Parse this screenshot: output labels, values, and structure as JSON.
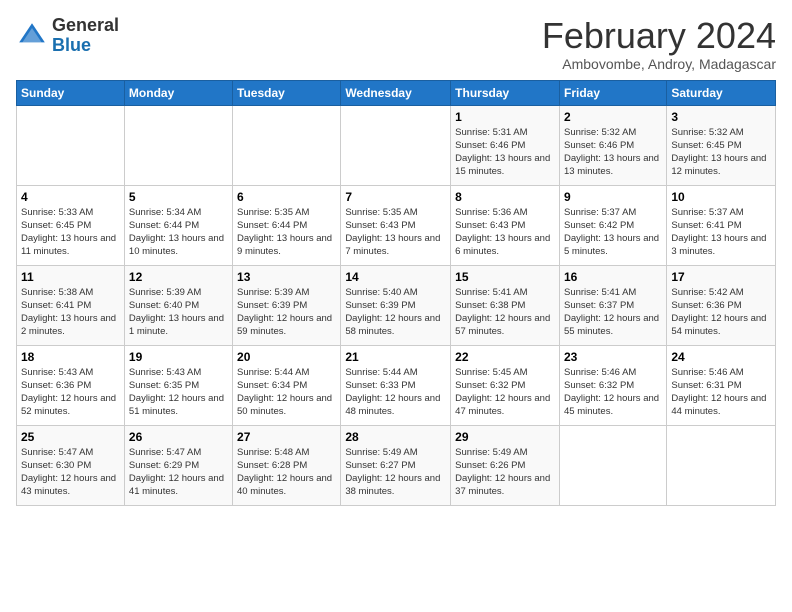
{
  "header": {
    "logo_general": "General",
    "logo_blue": "Blue",
    "month_title": "February 2024",
    "location": "Ambovombe, Androy, Madagascar"
  },
  "weekdays": [
    "Sunday",
    "Monday",
    "Tuesday",
    "Wednesday",
    "Thursday",
    "Friday",
    "Saturday"
  ],
  "weeks": [
    [
      {
        "day": "",
        "info": ""
      },
      {
        "day": "",
        "info": ""
      },
      {
        "day": "",
        "info": ""
      },
      {
        "day": "",
        "info": ""
      },
      {
        "day": "1",
        "info": "Sunrise: 5:31 AM\nSunset: 6:46 PM\nDaylight: 13 hours and 15 minutes."
      },
      {
        "day": "2",
        "info": "Sunrise: 5:32 AM\nSunset: 6:46 PM\nDaylight: 13 hours and 13 minutes."
      },
      {
        "day": "3",
        "info": "Sunrise: 5:32 AM\nSunset: 6:45 PM\nDaylight: 13 hours and 12 minutes."
      }
    ],
    [
      {
        "day": "4",
        "info": "Sunrise: 5:33 AM\nSunset: 6:45 PM\nDaylight: 13 hours and 11 minutes."
      },
      {
        "day": "5",
        "info": "Sunrise: 5:34 AM\nSunset: 6:44 PM\nDaylight: 13 hours and 10 minutes."
      },
      {
        "day": "6",
        "info": "Sunrise: 5:35 AM\nSunset: 6:44 PM\nDaylight: 13 hours and 9 minutes."
      },
      {
        "day": "7",
        "info": "Sunrise: 5:35 AM\nSunset: 6:43 PM\nDaylight: 13 hours and 7 minutes."
      },
      {
        "day": "8",
        "info": "Sunrise: 5:36 AM\nSunset: 6:43 PM\nDaylight: 13 hours and 6 minutes."
      },
      {
        "day": "9",
        "info": "Sunrise: 5:37 AM\nSunset: 6:42 PM\nDaylight: 13 hours and 5 minutes."
      },
      {
        "day": "10",
        "info": "Sunrise: 5:37 AM\nSunset: 6:41 PM\nDaylight: 13 hours and 3 minutes."
      }
    ],
    [
      {
        "day": "11",
        "info": "Sunrise: 5:38 AM\nSunset: 6:41 PM\nDaylight: 13 hours and 2 minutes."
      },
      {
        "day": "12",
        "info": "Sunrise: 5:39 AM\nSunset: 6:40 PM\nDaylight: 13 hours and 1 minute."
      },
      {
        "day": "13",
        "info": "Sunrise: 5:39 AM\nSunset: 6:39 PM\nDaylight: 12 hours and 59 minutes."
      },
      {
        "day": "14",
        "info": "Sunrise: 5:40 AM\nSunset: 6:39 PM\nDaylight: 12 hours and 58 minutes."
      },
      {
        "day": "15",
        "info": "Sunrise: 5:41 AM\nSunset: 6:38 PM\nDaylight: 12 hours and 57 minutes."
      },
      {
        "day": "16",
        "info": "Sunrise: 5:41 AM\nSunset: 6:37 PM\nDaylight: 12 hours and 55 minutes."
      },
      {
        "day": "17",
        "info": "Sunrise: 5:42 AM\nSunset: 6:36 PM\nDaylight: 12 hours and 54 minutes."
      }
    ],
    [
      {
        "day": "18",
        "info": "Sunrise: 5:43 AM\nSunset: 6:36 PM\nDaylight: 12 hours and 52 minutes."
      },
      {
        "day": "19",
        "info": "Sunrise: 5:43 AM\nSunset: 6:35 PM\nDaylight: 12 hours and 51 minutes."
      },
      {
        "day": "20",
        "info": "Sunrise: 5:44 AM\nSunset: 6:34 PM\nDaylight: 12 hours and 50 minutes."
      },
      {
        "day": "21",
        "info": "Sunrise: 5:44 AM\nSunset: 6:33 PM\nDaylight: 12 hours and 48 minutes."
      },
      {
        "day": "22",
        "info": "Sunrise: 5:45 AM\nSunset: 6:32 PM\nDaylight: 12 hours and 47 minutes."
      },
      {
        "day": "23",
        "info": "Sunrise: 5:46 AM\nSunset: 6:32 PM\nDaylight: 12 hours and 45 minutes."
      },
      {
        "day": "24",
        "info": "Sunrise: 5:46 AM\nSunset: 6:31 PM\nDaylight: 12 hours and 44 minutes."
      }
    ],
    [
      {
        "day": "25",
        "info": "Sunrise: 5:47 AM\nSunset: 6:30 PM\nDaylight: 12 hours and 43 minutes."
      },
      {
        "day": "26",
        "info": "Sunrise: 5:47 AM\nSunset: 6:29 PM\nDaylight: 12 hours and 41 minutes."
      },
      {
        "day": "27",
        "info": "Sunrise: 5:48 AM\nSunset: 6:28 PM\nDaylight: 12 hours and 40 minutes."
      },
      {
        "day": "28",
        "info": "Sunrise: 5:49 AM\nSunset: 6:27 PM\nDaylight: 12 hours and 38 minutes."
      },
      {
        "day": "29",
        "info": "Sunrise: 5:49 AM\nSunset: 6:26 PM\nDaylight: 12 hours and 37 minutes."
      },
      {
        "day": "",
        "info": ""
      },
      {
        "day": "",
        "info": ""
      }
    ]
  ]
}
